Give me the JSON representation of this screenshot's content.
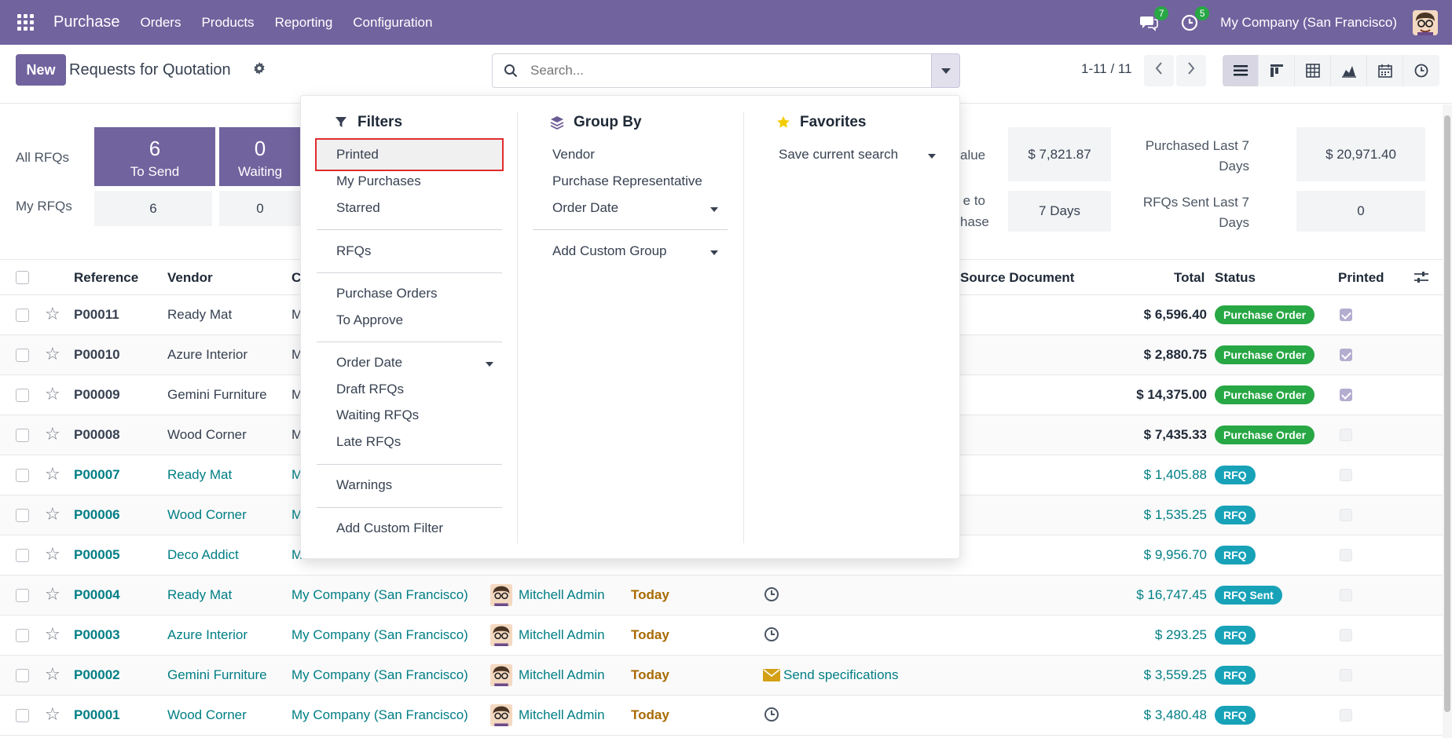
{
  "topbar": {
    "brand": "Purchase",
    "menu": [
      "Orders",
      "Products",
      "Reporting",
      "Configuration"
    ],
    "messages_count": "7",
    "activities_count": "5",
    "company": "My Company (San Francisco)"
  },
  "control": {
    "new_label": "New",
    "title": "Requests for Quotation",
    "search_placeholder": "Search...",
    "pager": "1-11 / 11"
  },
  "dashboard": {
    "all_rfqs_label": "All RFQs",
    "my_rfqs_label": "My RFQs",
    "to_send_count": "6",
    "to_send_label": "To Send",
    "waiting_count": "0",
    "waiting_label": "Waiting",
    "my_to_send": "6",
    "my_waiting": "0",
    "avg_value_label_visible": "alue",
    "avg_value": "$ 7,821.87",
    "lead_label_visible_1": "e to",
    "lead_label_visible_2": "hase",
    "lead_time": "7 Days",
    "purchased_label_1": "Purchased Last 7",
    "purchased_label_2": "Days",
    "purchased_value": "$ 20,971.40",
    "rfqs_sent_label_1": "RFQs Sent Last 7",
    "rfqs_sent_label_2": "Days",
    "rfqs_sent_value": "0"
  },
  "table": {
    "headers": {
      "reference": "Reference",
      "vendor": "Vendor",
      "company_partial": "C",
      "source": "Source Document",
      "total": "Total",
      "status": "Status",
      "printed": "Printed"
    },
    "rows": [
      {
        "ref": "P00011",
        "vendor": "Ready Mat",
        "company": "M",
        "buyer": "",
        "deadline": "",
        "activity": "",
        "total": "$ 6,596.40",
        "status": "Purchase Order",
        "kind": "po",
        "printed": true
      },
      {
        "ref": "P00010",
        "vendor": "Azure Interior",
        "company": "M",
        "buyer": "",
        "deadline": "",
        "activity": "",
        "total": "$ 2,880.75",
        "status": "Purchase Order",
        "kind": "po",
        "printed": true
      },
      {
        "ref": "P00009",
        "vendor": "Gemini Furniture",
        "company": "M",
        "buyer": "",
        "deadline": "",
        "activity": "",
        "total": "$ 14,375.00",
        "status": "Purchase Order",
        "kind": "po",
        "printed": true
      },
      {
        "ref": "P00008",
        "vendor": "Wood Corner",
        "company": "M",
        "buyer": "",
        "deadline": "",
        "activity": "",
        "total": "$ 7,435.33",
        "status": "Purchase Order",
        "kind": "po",
        "printed": false
      },
      {
        "ref": "P00007",
        "vendor": "Ready Mat",
        "company": "M",
        "buyer": "",
        "deadline": "",
        "activity": "",
        "total": "$ 1,405.88",
        "status": "RFQ",
        "kind": "rfq",
        "printed": false
      },
      {
        "ref": "P00006",
        "vendor": "Wood Corner",
        "company": "M",
        "buyer": "",
        "deadline": "",
        "activity": "",
        "total": "$ 1,535.25",
        "status": "RFQ",
        "kind": "rfq",
        "printed": false
      },
      {
        "ref": "P00005",
        "vendor": "Deco Addict",
        "company": "M",
        "buyer": "",
        "deadline": "",
        "activity": "",
        "total": "$ 9,956.70",
        "status": "RFQ",
        "kind": "rfq",
        "printed": false
      },
      {
        "ref": "P00004",
        "vendor": "Ready Mat",
        "company": "My Company (San Francisco)",
        "buyer": "Mitchell Admin",
        "deadline": "Today",
        "activity": "",
        "total": "$ 16,747.45",
        "status": "RFQ Sent",
        "kind": "rfq",
        "printed": false
      },
      {
        "ref": "P00003",
        "vendor": "Azure Interior",
        "company": "My Company (San Francisco)",
        "buyer": "Mitchell Admin",
        "deadline": "Today",
        "activity": "",
        "total": "$ 293.25",
        "status": "RFQ",
        "kind": "rfq",
        "printed": false
      },
      {
        "ref": "P00002",
        "vendor": "Gemini Furniture",
        "company": "My Company (San Francisco)",
        "buyer": "Mitchell Admin",
        "deadline": "Today",
        "activity": "Send specifications",
        "total": "$ 3,559.25",
        "status": "RFQ",
        "kind": "rfq",
        "printed": false
      },
      {
        "ref": "P00001",
        "vendor": "Wood Corner",
        "company": "My Company (San Francisco)",
        "buyer": "Mitchell Admin",
        "deadline": "Today",
        "activity": "",
        "total": "$ 3,480.48",
        "status": "RFQ",
        "kind": "rfq",
        "printed": false
      }
    ]
  },
  "dropdown": {
    "filters_title": "Filters",
    "filters": [
      "Printed",
      "My Purchases",
      "Starred",
      "RFQs",
      "Purchase Orders",
      "To Approve",
      "Order Date",
      "Draft RFQs",
      "Waiting RFQs",
      "Late RFQs",
      "Warnings",
      "Add Custom Filter"
    ],
    "groupby_title": "Group By",
    "groupby": [
      "Vendor",
      "Purchase Representative",
      "Order Date",
      "Add Custom Group"
    ],
    "favorites_title": "Favorites",
    "favorites": [
      "Save current search"
    ]
  },
  "colors": {
    "brand": "#71639e",
    "link": "#017e84",
    "success": "#28a745",
    "info": "#17a2b8",
    "highlight_border": "#e02d2d"
  },
  "icons": [
    "apps-icon",
    "chat-icon",
    "clock-icon",
    "gear-icon",
    "search-icon",
    "caret-down-icon",
    "chevron-left-icon",
    "chevron-right-icon",
    "list-view-icon",
    "kanban-view-icon",
    "pivot-view-icon",
    "graph-view-icon",
    "calendar-view-icon",
    "activity-view-icon",
    "filter-icon",
    "layers-icon",
    "star-icon",
    "envelope-icon",
    "settings-sliders-icon"
  ]
}
